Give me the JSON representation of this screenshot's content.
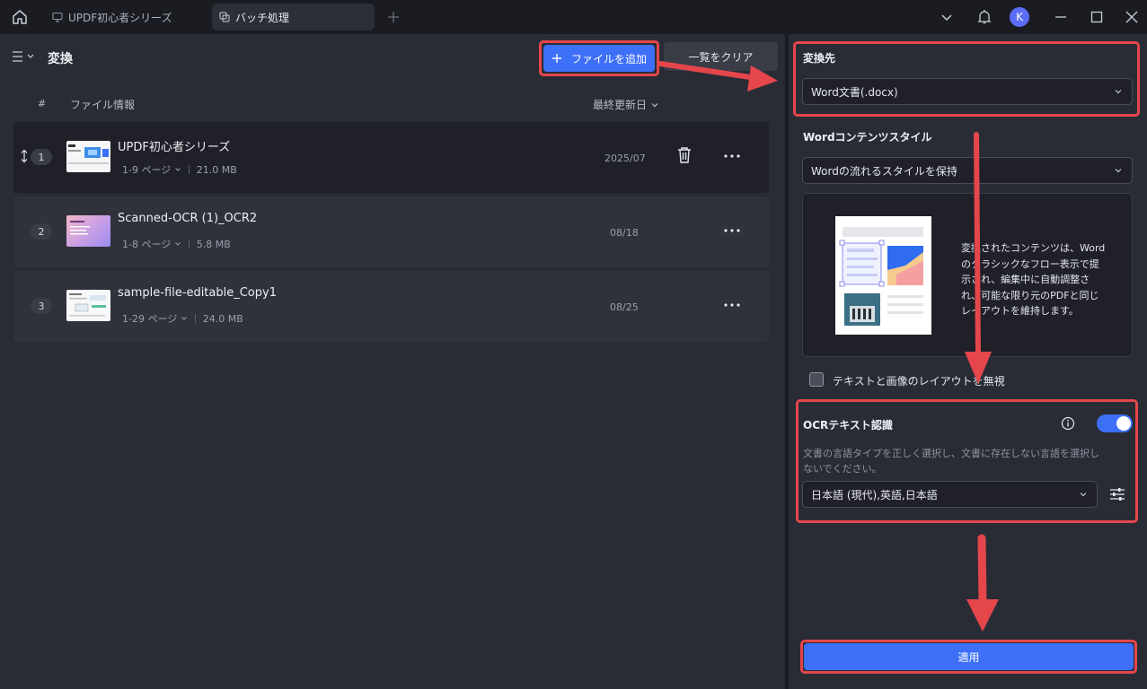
{
  "tabs": [
    {
      "label": "UPDF初心者シリーズ",
      "active": false
    },
    {
      "label": "バッチ処理",
      "active": true
    }
  ],
  "user": {
    "avatar_letter": "K",
    "avatar_color": "#5b6cf5"
  },
  "left": {
    "title": "変換",
    "add_file_label": "ファイルを追加",
    "clear_list_label": "一覧をクリア",
    "columns": {
      "index": "#",
      "file_info": "ファイル情報",
      "modified": "最終更新日"
    },
    "files": [
      {
        "index": "1",
        "name": "UPDF初心者シリーズ",
        "pages": "1-9 ページ",
        "size": "21.0 MB",
        "date": "2025/07"
      },
      {
        "index": "2",
        "name": "Scanned-OCR (1)_OCR2",
        "pages": "1-8 ページ",
        "size": "5.8 MB",
        "date": "08/18"
      },
      {
        "index": "3",
        "name": "sample-file-editable_Copy1",
        "pages": "1-29 ページ",
        "size": "24.0 MB",
        "date": "08/25"
      }
    ]
  },
  "right": {
    "dest_label": "変換先",
    "dest_value": "Word文書(.docx)",
    "style_label": "Wordコンテンツスタイル",
    "style_value": "Wordの流れるスタイルを保持",
    "style_desc_lines": [
      "変換されたコンテンツは、Word",
      "のクラシックなフロー表示で提",
      "示され、編集中に自動調整さ",
      "れ、可能な限り元のPDFと同じ",
      "レイアウトを維持します。"
    ],
    "ignore_layout_label": "テキストと画像のレイアウトを無視",
    "ocr_label": "OCRテキスト認識",
    "ocr_enabled": true,
    "ocr_desc_lines": [
      "文書の言語タイプを正しく選択し、文書に存在しない言語を選択し",
      "ないでください。"
    ],
    "ocr_language": "日本語 (現代),英語,日本語",
    "apply_label": "適用"
  },
  "colors": {
    "accent": "#3d6ff7",
    "highlight": "#e4464b"
  }
}
